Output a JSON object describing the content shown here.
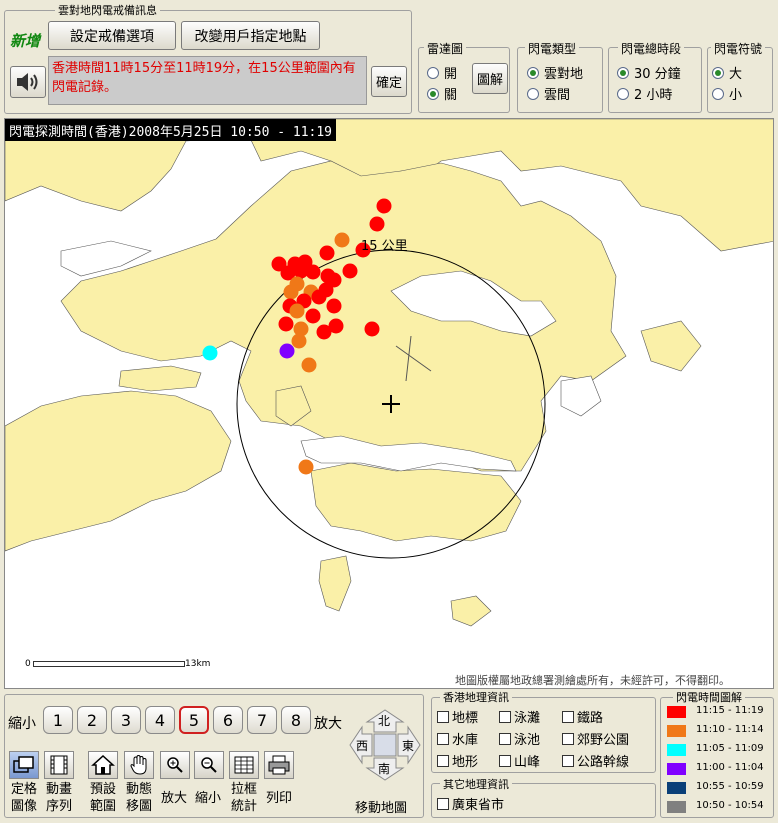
{
  "warning_panel": {
    "title": "雲對地閃電戒備訊息",
    "new_badge": "新增",
    "btn_set_alert": "設定戒備選項",
    "btn_change_location": "改變用戶指定地點",
    "message": "香港時間11時15分至11時19分，在15公里範圍內有閃電記錄。",
    "btn_confirm": "確定"
  },
  "radar_group": {
    "title": "雷達圖",
    "opt_on": "開",
    "opt_off": "關",
    "selected": "關",
    "btn_legend": "圖解"
  },
  "type_group": {
    "title": "閃電類型",
    "opt_cg": "雲對地",
    "opt_cc": "雲間",
    "selected": "雲對地"
  },
  "period_group": {
    "title": "閃電總時段",
    "opt_30": "30 分鐘",
    "opt_2h": "2 小時",
    "selected": "30 分鐘"
  },
  "symbol_group": {
    "title": "閃電符號",
    "opt_big": "大",
    "opt_small": "小",
    "selected": "大"
  },
  "map": {
    "header": "閃電探測時間(香港)2008年5月25日 10:50 - 11:19",
    "radius_label": "15 公里",
    "scale_start": "0",
    "scale_end": "13km",
    "copyright": "地圖版權屬地政總署測繪處所有，未經許可，不得翻印。"
  },
  "zoom": {
    "label_out": "縮小",
    "label_in": "放大",
    "levels": [
      "1",
      "2",
      "3",
      "4",
      "5",
      "6",
      "7",
      "8"
    ],
    "selected": "5"
  },
  "tools": {
    "fixed_image": "定格\n圖像",
    "animation": "動畫\n序列",
    "preset": "預設\n範圍",
    "pan": "動態\n移圖",
    "zoom_in": "放大",
    "zoom_out": "縮小",
    "box_stats": "拉框\n統計",
    "print": "列印"
  },
  "nav": {
    "north": "北",
    "south": "南",
    "east": "東",
    "west": "西",
    "label": "移動地圖"
  },
  "geo_info": {
    "title": "香港地理資訊",
    "items": [
      "地標",
      "泳灘",
      "鐵路",
      "水庫",
      "泳池",
      "郊野公園",
      "地形",
      "山峰",
      "公路幹線"
    ]
  },
  "other_geo": {
    "title": "其它地理資訊",
    "items": [
      "廣東省市"
    ]
  },
  "time_legend": {
    "title": "閃電時間圖解",
    "items": [
      {
        "label": "11:15 - 11:19",
        "color": "#ff0000"
      },
      {
        "label": "11:10 - 11:14",
        "color": "#f07818"
      },
      {
        "label": "11:05 - 11:09",
        "color": "#00ffff"
      },
      {
        "label": "11:00 - 11:04",
        "color": "#8000ff"
      },
      {
        "label": "10:55 - 10:59",
        "color": "#0a3f78"
      },
      {
        "label": "10:50 - 10:54",
        "color": "#808080"
      }
    ]
  },
  "strikes": [
    {
      "lon": 383,
      "lat": 205,
      "p": 0
    },
    {
      "lon": 376,
      "lat": 223,
      "p": 0
    },
    {
      "lon": 341,
      "lat": 239,
      "p": 1
    },
    {
      "lon": 362,
      "lat": 249,
      "p": 0
    },
    {
      "lon": 326,
      "lat": 252,
      "p": 0
    },
    {
      "lon": 304,
      "lat": 261,
      "p": 0
    },
    {
      "lon": 294,
      "lat": 263,
      "p": 0
    },
    {
      "lon": 278,
      "lat": 263,
      "p": 0
    },
    {
      "lon": 287,
      "lat": 272,
      "p": 0
    },
    {
      "lon": 300,
      "lat": 270,
      "p": 0
    },
    {
      "lon": 312,
      "lat": 271,
      "p": 0
    },
    {
      "lon": 349,
      "lat": 270,
      "p": 0
    },
    {
      "lon": 327,
      "lat": 275,
      "p": 0
    },
    {
      "lon": 296,
      "lat": 283,
      "p": 1
    },
    {
      "lon": 290,
      "lat": 291,
      "p": 1
    },
    {
      "lon": 310,
      "lat": 291,
      "p": 1
    },
    {
      "lon": 325,
      "lat": 289,
      "p": 0
    },
    {
      "lon": 333,
      "lat": 279,
      "p": 0
    },
    {
      "lon": 318,
      "lat": 296,
      "p": 0
    },
    {
      "lon": 303,
      "lat": 300,
      "p": 0
    },
    {
      "lon": 289,
      "lat": 305,
      "p": 0
    },
    {
      "lon": 333,
      "lat": 305,
      "p": 0
    },
    {
      "lon": 296,
      "lat": 310,
      "p": 1
    },
    {
      "lon": 312,
      "lat": 315,
      "p": 0
    },
    {
      "lon": 285,
      "lat": 323,
      "p": 0
    },
    {
      "lon": 300,
      "lat": 328,
      "p": 1
    },
    {
      "lon": 323,
      "lat": 331,
      "p": 0
    },
    {
      "lon": 335,
      "lat": 325,
      "p": 0
    },
    {
      "lon": 371,
      "lat": 328,
      "p": 0
    },
    {
      "lon": 298,
      "lat": 340,
      "p": 1
    },
    {
      "lon": 286,
      "lat": 350,
      "p": 3
    },
    {
      "lon": 308,
      "lat": 364,
      "p": 1
    },
    {
      "lon": 209,
      "lat": 352,
      "p": 2
    },
    {
      "lon": 305,
      "lat": 466,
      "p": 1
    }
  ]
}
